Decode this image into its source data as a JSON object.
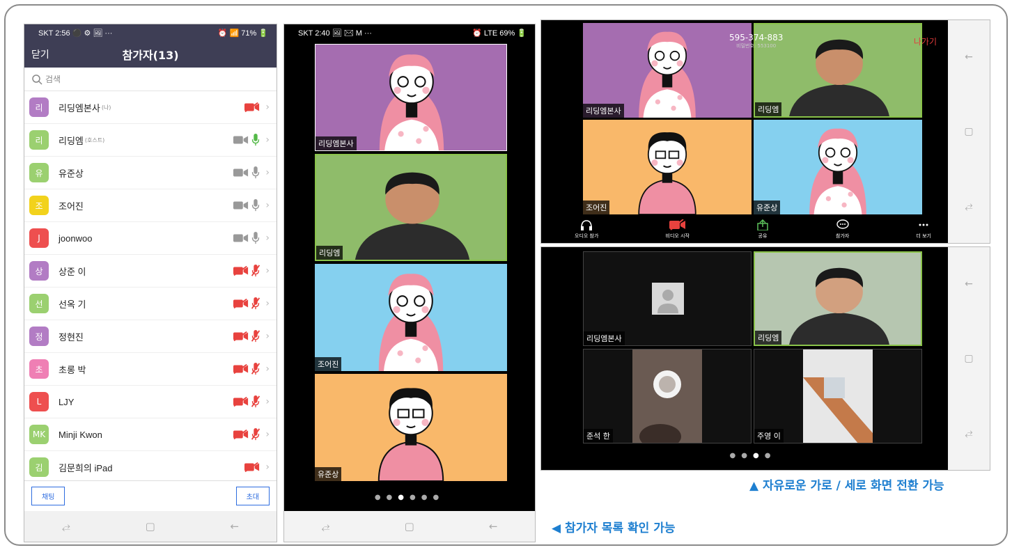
{
  "phone1": {
    "status_left": "SKT 2:56 ⚫ ⚙ 🖼 ···",
    "status_right": "⏰ 📶 71% 🔋",
    "close_label": "닫기",
    "title": "참가자(13)",
    "search_placeholder": "검색",
    "participants": [
      {
        "initial": "리",
        "name": "리딩엠본사",
        "tag": "(나)",
        "color": "#b27cc4",
        "video": "off",
        "mic": "none"
      },
      {
        "initial": "리",
        "name": "리딩엠",
        "tag": "(호스트)",
        "color": "#9bd070",
        "video": "on",
        "mic": "active"
      },
      {
        "initial": "유",
        "name": "유준상",
        "tag": "",
        "color": "#9bd070",
        "video": "on",
        "mic": "on"
      },
      {
        "initial": "조",
        "name": "조어진",
        "tag": "",
        "color": "#f2d21c",
        "video": "on",
        "mic": "on"
      },
      {
        "initial": "J",
        "name": "joonwoo",
        "tag": "",
        "color": "#ee4f4f",
        "video": "on",
        "mic": "on"
      },
      {
        "initial": "상",
        "name": "상준 이",
        "tag": "",
        "color": "#b27cc4",
        "video": "off",
        "mic": "off"
      },
      {
        "initial": "선",
        "name": "선옥 기",
        "tag": "",
        "color": "#9bd070",
        "video": "off",
        "mic": "off"
      },
      {
        "initial": "정",
        "name": "정현진",
        "tag": "",
        "color": "#b27cc4",
        "video": "off",
        "mic": "off"
      },
      {
        "initial": "초",
        "name": "초롱 박",
        "tag": "",
        "color": "#ef7fb4",
        "video": "off",
        "mic": "off"
      },
      {
        "initial": "L",
        "name": "LJY",
        "tag": "",
        "color": "#ee4f4f",
        "video": "off",
        "mic": "off"
      },
      {
        "initial": "MK",
        "name": "Minji Kwon",
        "tag": "",
        "color": "#9bd070",
        "video": "off",
        "mic": "off"
      },
      {
        "initial": "김",
        "name": "김문희의 iPad",
        "tag": "",
        "color": "#9bd070",
        "video": "off",
        "mic": "none"
      }
    ],
    "chat_button": "채팅",
    "invite_button": "초대"
  },
  "phone2": {
    "status_left": "SKT 2:40 🖼 ✉ M ···",
    "status_right": "⏰ LTE 69% 🔋",
    "tiles": [
      {
        "name": "리딩엠본사"
      },
      {
        "name": "리딩엠"
      },
      {
        "name": "조어진"
      },
      {
        "name": "유준상"
      }
    ]
  },
  "landscape1": {
    "meeting_id": "595-374-883",
    "password_text": "비밀번호: 553100",
    "leave_label": "나가기",
    "tiles": [
      {
        "name": "리딩엠본사"
      },
      {
        "name": "리딩엠"
      },
      {
        "name": "조어진"
      },
      {
        "name": "유준상"
      }
    ],
    "toolbar": [
      {
        "label": "오디오 참가"
      },
      {
        "label": "비디오 시작"
      },
      {
        "label": "공유"
      },
      {
        "label": "참가자"
      },
      {
        "label": "더 보기"
      }
    ]
  },
  "landscape2": {
    "tiles": [
      {
        "name": "리딩엠본사"
      },
      {
        "name": "리딩엠"
      },
      {
        "name": "준석 한"
      },
      {
        "name": "주영 이"
      }
    ]
  },
  "captions": {
    "rotate": "▲ 자유로운 가로 / 세로 화면 전환 가능",
    "list": "◀ 참가자 목록 확인 가능"
  },
  "colors": {
    "accent": "#1e7fd0",
    "header_bg": "#3e3e55",
    "leave_red": "#e23b3b",
    "mute_red": "#e8423e"
  }
}
